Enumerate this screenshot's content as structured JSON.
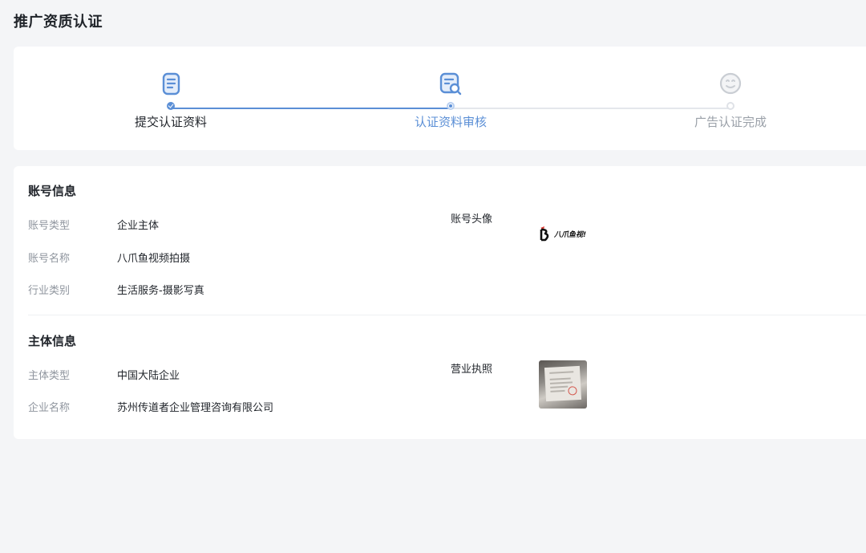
{
  "page": {
    "title": "推广资质认证"
  },
  "steps": [
    {
      "label": "提交认证资料",
      "state": "done",
      "icon": "document-icon"
    },
    {
      "label": "认证资料审核",
      "state": "active",
      "icon": "document-search-icon"
    },
    {
      "label": "广告认证完成",
      "state": "pending",
      "icon": "smile-icon"
    }
  ],
  "account": {
    "title": "账号信息",
    "rows": [
      {
        "label": "账号类型",
        "value": "企业主体"
      },
      {
        "label": "账号名称",
        "value": "八爪鱼视频拍摄"
      },
      {
        "label": "行业类别",
        "value": "生活服务-摄影写真"
      }
    ],
    "avatar_label": "账号头像",
    "avatar_text": "八爪鱼视!"
  },
  "subject": {
    "title": "主体信息",
    "rows": [
      {
        "label": "主体类型",
        "value": "中国大陆企业"
      },
      {
        "label": "企业名称",
        "value": "苏州传道者企业管理咨询有限公司"
      }
    ],
    "license_label": "营业执照"
  },
  "colors": {
    "accent": "#5b8fd6",
    "pending": "#c9cdd3",
    "text": "#1f2329",
    "muted": "#8f959e"
  }
}
